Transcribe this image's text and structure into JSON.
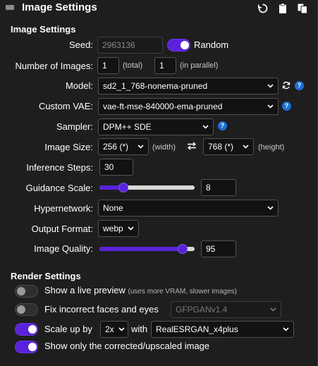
{
  "header": {
    "title": "Image Settings",
    "icons": [
      "reset-icon",
      "clipboard-icon",
      "copy-icon"
    ]
  },
  "image_settings": {
    "title": "Image Settings",
    "seed": {
      "label": "Seed:",
      "value": "2963136",
      "random_label": "Random",
      "random_on": true
    },
    "num_images": {
      "label": "Number of Images:",
      "total": "1",
      "total_note": "(total)",
      "parallel": "1",
      "parallel_note": "(in parallel)"
    },
    "model": {
      "label": "Model:",
      "value": "sd2_1_768-nonema-pruned"
    },
    "vae": {
      "label": "Custom VAE:",
      "value": "vae-ft-mse-840000-ema-pruned"
    },
    "sampler": {
      "label": "Sampler:",
      "value": "DPM++ SDE"
    },
    "image_size": {
      "label": "Image Size:",
      "width": "256 (*)",
      "width_note": "(width)",
      "height": "768 (*)",
      "height_note": "(height)"
    },
    "steps": {
      "label": "Inference Steps:",
      "value": "30"
    },
    "guidance": {
      "label": "Guidance Scale:",
      "value": "8",
      "fraction": 0.22
    },
    "hypernetwork": {
      "label": "Hypernetwork:",
      "value": "None"
    },
    "output_format": {
      "label": "Output Format:",
      "value": "webp"
    },
    "quality": {
      "label": "Image Quality:",
      "value": "95",
      "fraction": 0.92
    }
  },
  "render_settings": {
    "title": "Render Settings",
    "live_preview": {
      "label": "Show a live preview",
      "note": "(uses more VRAM, slower images)",
      "on": false
    },
    "fix_faces": {
      "label": "Fix incorrect faces and eyes",
      "model": "GFPGANv1.4",
      "on": false
    },
    "upscale": {
      "label": "Scale up by",
      "factor": "2x",
      "with_label": "with",
      "model": "RealESRGAN_x4plus",
      "on": true
    },
    "show_corrected": {
      "label": "Show only the corrected/upscaled image",
      "on": true
    }
  },
  "colors": {
    "accent": "#5a22d9",
    "help": "#1e6fd6",
    "background": "#1e1e1e"
  }
}
